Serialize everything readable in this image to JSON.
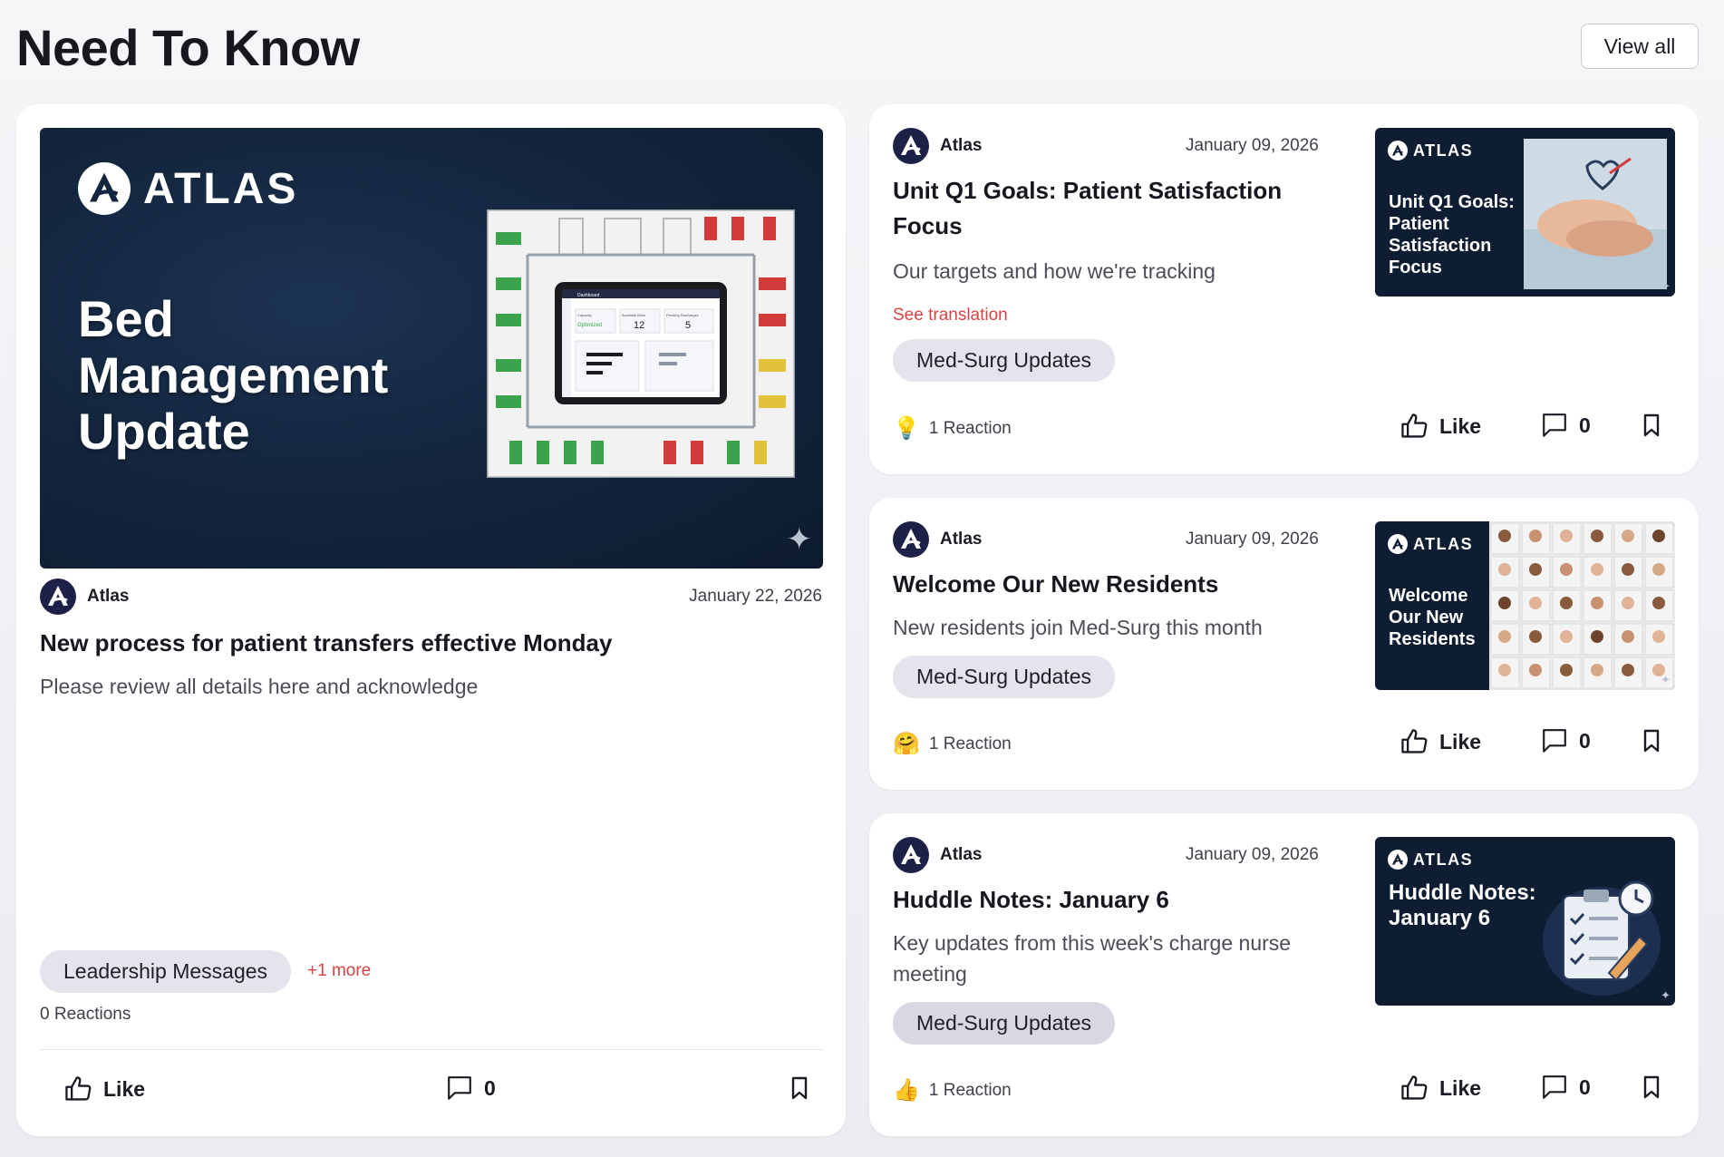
{
  "header": {
    "title": "Need To Know",
    "view_all_label": "View all"
  },
  "featured": {
    "hero": {
      "brand": "ATLAS",
      "title": "Bed Management Update"
    },
    "author": "Atlas",
    "date": "January 22, 2026",
    "title": "New process for patient transfers effective Monday",
    "subtitle": "Please review all details here and acknowledge",
    "tag": "Leadership Messages",
    "more_tags": "+1 more",
    "reactions": "0 Reactions",
    "like_label": "Like",
    "comment_count": "0"
  },
  "posts": [
    {
      "author": "Atlas",
      "date": "January 09, 2026",
      "title": "Unit Q1 Goals: Patient Satisfaction Focus",
      "subtitle": "Our targets and how we're tracking",
      "translation": "See translation",
      "tag": "Med-Surg Updates",
      "reaction_icon": "lightbulb-icon",
      "reactions": "1 Reaction",
      "like_label": "Like",
      "comment_count": "0",
      "thumb_brand": "ATLAS",
      "thumb_title": "Unit Q1 Goals: Patient Satisfaction Focus"
    },
    {
      "author": "Atlas",
      "date": "January 09, 2026",
      "title": "Welcome Our New Residents",
      "subtitle": "New residents join Med-Surg this month",
      "tag": "Med-Surg Updates",
      "reaction_icon": "hug-emoji-icon",
      "reactions": "1 Reaction",
      "like_label": "Like",
      "comment_count": "0",
      "thumb_brand": "ATLAS",
      "thumb_title": "Welcome Our New Residents"
    },
    {
      "author": "Atlas",
      "date": "January 09, 2026",
      "title": "Huddle Notes: January 6",
      "subtitle": "Key updates from this week's charge nurse meeting",
      "tag": "Med-Surg Updates",
      "reaction_icon": "thumbs-up-emoji-icon",
      "reactions": "1 Reaction",
      "like_label": "Like",
      "comment_count": "0",
      "thumb_brand": "ATLAS",
      "thumb_title": "Huddle Notes: January 6"
    }
  ],
  "hero_dashboard": {
    "title": "Dashboard",
    "stats": [
      {
        "label": "Capacity",
        "value": "Optimized"
      },
      {
        "label": "Available Beds",
        "value": "12"
      },
      {
        "label": "Pending Discharges",
        "value": "5"
      }
    ]
  },
  "colors": {
    "accent_red": "#d64545",
    "navy": "#1e2147",
    "chip_bg": "#e4e4ec"
  }
}
